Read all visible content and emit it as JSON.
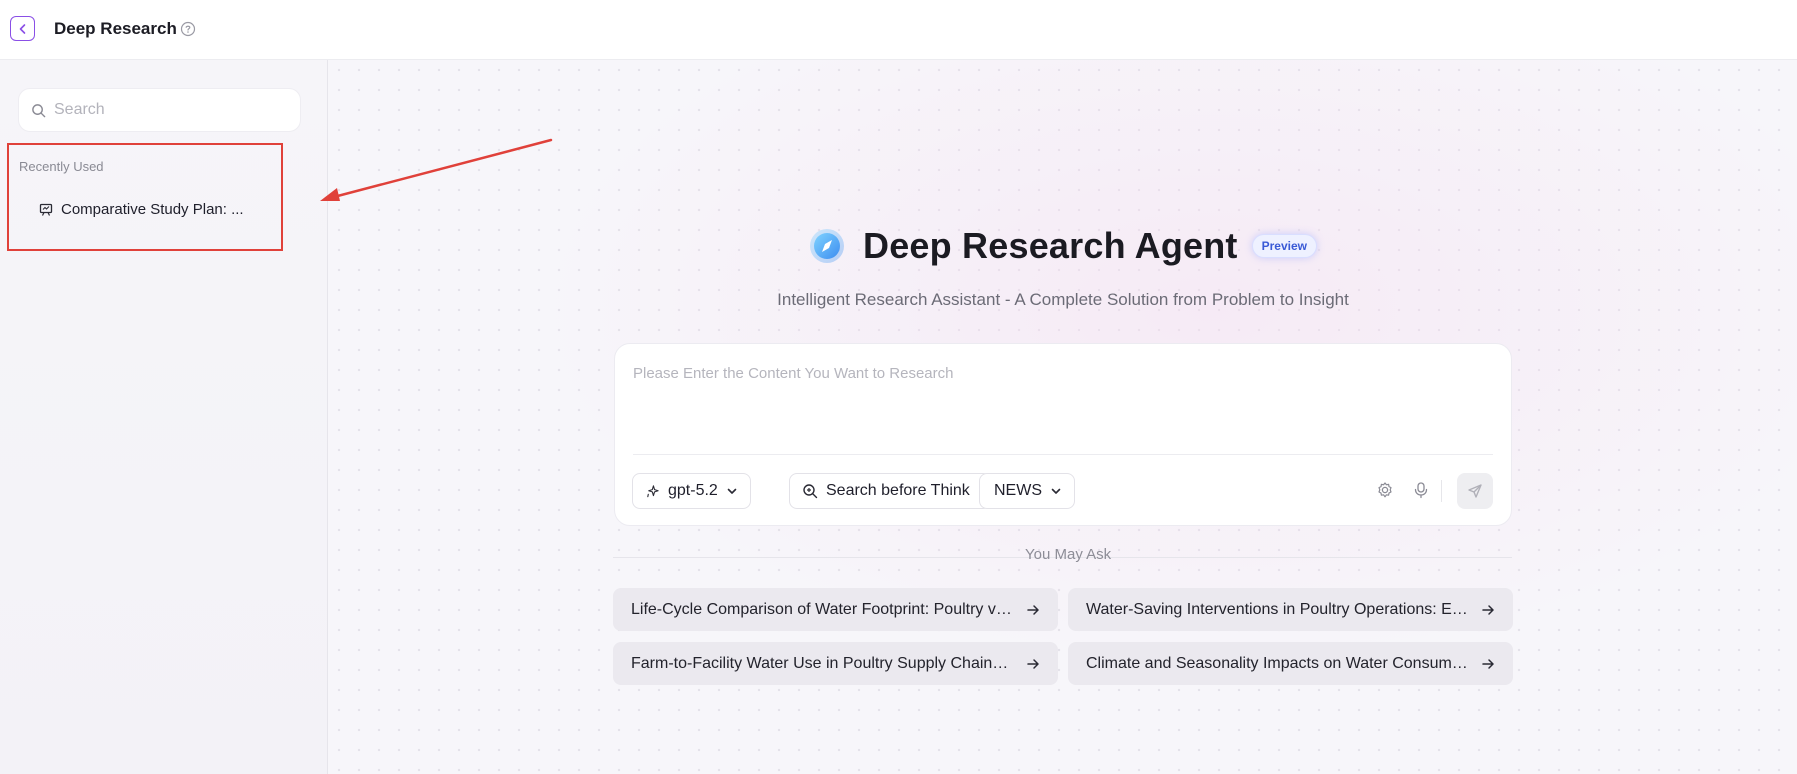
{
  "header": {
    "title": "Deep Research",
    "back_icon": "chevron-left-icon",
    "help_icon": "question-circle-icon"
  },
  "sidebar": {
    "search_placeholder": "Search",
    "recent_label": "Recently Used",
    "recent_items": [
      {
        "label": "Comparative Study Plan: ...",
        "icon": "presentation-icon"
      }
    ]
  },
  "hero": {
    "title": "Deep Research Agent",
    "badge": "Preview",
    "subtitle": "Intelligent Research Assistant - A Complete Solution from Problem to Insight"
  },
  "composer": {
    "placeholder": "Please Enter the Content You Want to Research",
    "model_label": "gpt-5.2",
    "search_label": "Search before Think",
    "source_label": "NEWS"
  },
  "suggestions": {
    "label": "You May Ask",
    "items": [
      "Life-Cycle Comparison of Water Footprint: Poultry vs....",
      "Water-Saving Interventions in Poultry Operations: Eff...",
      "Farm-to-Facility Water Use in Poultry Supply Chains: ...",
      "Climate and Seasonality Impacts on Water Consump..."
    ]
  },
  "colors": {
    "accent": "#8a4fe6",
    "highlight": "#e0413a",
    "badge": "#3a5ad6"
  }
}
